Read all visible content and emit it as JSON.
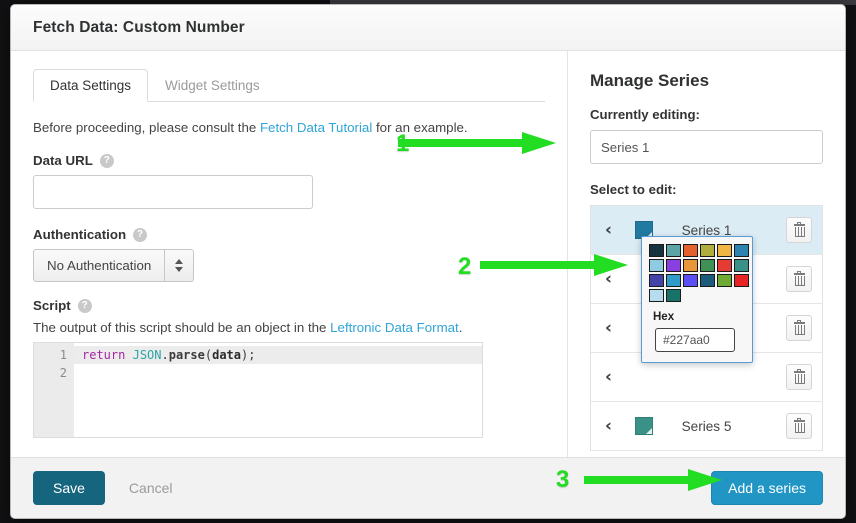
{
  "window": {
    "title": "Fetch Data: Custom Number"
  },
  "tabs": [
    {
      "label": "Data Settings",
      "active": true
    },
    {
      "label": "Widget Settings",
      "active": false
    }
  ],
  "left": {
    "intro_before": "Before proceeding, please consult the ",
    "intro_link": "Fetch Data Tutorial",
    "intro_after": " for an example.",
    "data_url_label": "Data URL",
    "data_url_value": "",
    "data_url_placeholder": "",
    "auth_label": "Authentication",
    "auth_value": "No Authentication",
    "script_label": "Script",
    "script_desc_before": "The output of this script should be an object in the ",
    "script_desc_link": "Leftronic Data Format",
    "script_desc_after": ".",
    "help_glyph": "?",
    "code": {
      "line_numbers": [
        "1",
        "2"
      ],
      "tokens": {
        "kw": "return",
        "space": " ",
        "obj": "JSON",
        "dot": ".",
        "fn": "parse",
        "open": "(",
        "arg": "data",
        "close": ");"
      },
      "full_line": "return JSON.parse(data);"
    }
  },
  "right": {
    "panel_title": "Manage Series",
    "currently_editing_label": "Currently editing:",
    "currently_editing_value": "Series 1",
    "select_to_edit_label": "Select to edit:",
    "chevron_glyph": "‹",
    "series": [
      {
        "name": "Series 1",
        "color": "#227aa0",
        "selected": true,
        "show_swatch": true,
        "show_name": true
      },
      {
        "name": "",
        "color": "",
        "selected": false,
        "show_swatch": false,
        "show_name": false
      },
      {
        "name": "",
        "color": "",
        "selected": false,
        "show_swatch": false,
        "show_name": false
      },
      {
        "name": "",
        "color": "",
        "selected": false,
        "show_swatch": false,
        "show_name": false
      },
      {
        "name": "Series 5",
        "color": "#3a9188",
        "selected": false,
        "show_swatch": true,
        "show_name": true
      }
    ]
  },
  "color_picker": {
    "hex_label": "Hex",
    "hex_value": "#227aa0",
    "swatches": [
      "#16323f",
      "#5ba5a5",
      "#e4602d",
      "#b0ae3f",
      "#f0b543",
      "#2d83b0",
      "#8fcbe2",
      "#8a3fe0",
      "#e8963a",
      "#3f9156",
      "#e43b32",
      "#3a9188",
      "#4444a8",
      "#2f9bc8",
      "#5b4ef5",
      "#1a5c7a",
      "#6eab33",
      "#e72526",
      "#b6dced",
      "#177368"
    ]
  },
  "footer": {
    "save_label": "Save",
    "cancel_label": "Cancel",
    "add_series_label": "Add a series"
  },
  "annotations": [
    {
      "number": "1"
    },
    {
      "number": "2"
    },
    {
      "number": "3"
    }
  ],
  "colors": {
    "accent_save": "#16657f",
    "accent_add": "#2196c4",
    "link": "#2fa4d6",
    "annotation_green": "#22dd22",
    "row_selected": "#dcecf4"
  }
}
